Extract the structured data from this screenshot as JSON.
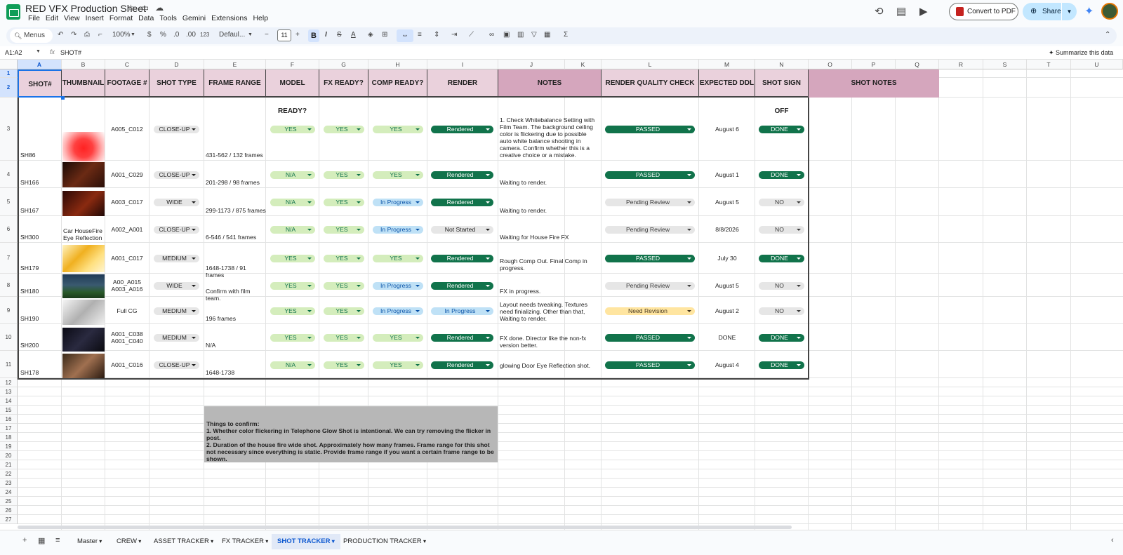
{
  "app": {
    "title": "RED VFX Production Sheet",
    "menu": [
      "File",
      "Edit",
      "View",
      "Insert",
      "Format",
      "Data",
      "Tools",
      "Gemini",
      "Extensions",
      "Help"
    ],
    "convert_label": "Convert to PDF",
    "share_label": "Share"
  },
  "toolbar": {
    "search_label": "Menus",
    "zoom": "100%",
    "currency": "$",
    "percent": "%",
    "dec_dec": ".0",
    "dec_inc": ".00",
    "num_format": "123",
    "font": "Defaul...",
    "font_size": "11"
  },
  "formula_bar": {
    "name_box": "A1:A2",
    "fx": "fx",
    "value": "SHOT#",
    "summarize": "Summarize this data"
  },
  "columns": [
    "A",
    "B",
    "C",
    "D",
    "E",
    "F",
    "G",
    "H",
    "I",
    "J",
    "K",
    "L",
    "M",
    "N",
    "O",
    "P",
    "Q",
    "R",
    "S",
    "T",
    "U"
  ],
  "row_numbers": [
    "1",
    "2",
    "3",
    "4",
    "5",
    "6",
    "7",
    "8",
    "9",
    "10",
    "11",
    "12",
    "13",
    "14",
    "15",
    "16",
    "17",
    "18",
    "19",
    "20",
    "21",
    "22",
    "23",
    "24",
    "25",
    "26",
    "27"
  ],
  "headers": {
    "shot": "SHOT#",
    "thumbnail": "THUMBNAIL",
    "footage": "FOOTAGE #",
    "shot_type": "SHOT TYPE",
    "frame_range": "FRAME RANGE",
    "model_ready": "MODEL READY?",
    "fx_ready": "FX READY?",
    "comp_ready": "COMP READY?",
    "render": "RENDER",
    "notes": "NOTES",
    "render_qc": "RENDER QUALITY CHECK",
    "expected_ddl": "EXPECTED DDL",
    "sign_off": "SHOT SIGN OFF",
    "shot_notes": "SHOT NOTES"
  },
  "rows": [
    {
      "shot": "SH86",
      "thumb_text": "",
      "footage": "A005_C012",
      "type": "CLOSE-UP",
      "frames": "431-562 / 132 frames",
      "model": "YES",
      "fx": "YES",
      "comp": "YES",
      "render": "Rendered",
      "notes": "1. Check Whitebalance Setting with Film Team. The background ceiling color is flickering due to possible auto white balance shooting in camera. Confirm whether this is a creative choice or a mistake.",
      "qc": "PASSED",
      "ddl": "August 6",
      "signoff": "DONE"
    },
    {
      "shot": "SH166",
      "thumb_text": "",
      "footage": "A001_C029",
      "type": "CLOSE-UP",
      "frames": "201-298 / 98 frames",
      "model": "N/A",
      "fx": "YES",
      "comp": "YES",
      "render": "Rendered",
      "notes": "Waiting to render.",
      "qc": "PASSED",
      "ddl": "August 1",
      "signoff": "DONE"
    },
    {
      "shot": "SH167",
      "thumb_text": "",
      "footage": "A003_C017",
      "type": "WIDE",
      "frames": "299-1173 / 875 frames",
      "model": "N/A",
      "fx": "YES",
      "comp": "In Progress",
      "render": "Rendered",
      "notes": "Waiting to render.",
      "qc": "Pending Review",
      "ddl": "August 5",
      "signoff": "NO"
    },
    {
      "shot": "SH300",
      "thumb_text": "Car HouseFire Eye Reflection",
      "footage": "A002_A001",
      "type": "CLOSE-UP",
      "frames": "6-546 / 541 frames",
      "model": "N/A",
      "fx": "YES",
      "comp": "In Progress",
      "render": "Not Started",
      "notes": "Waiting for House Fire FX",
      "qc": "Pending Review",
      "ddl": "8/8/2026",
      "signoff": "NO"
    },
    {
      "shot": "SH179",
      "thumb_text": "",
      "footage": "A001_C017",
      "type": "MEDIUM",
      "frames": "1648-1738 / 91 frames",
      "model": "YES",
      "fx": "YES",
      "comp": "YES",
      "render": "Rendered",
      "notes": "Rough Comp Out. Final Comp in progress.",
      "qc": "PASSED",
      "ddl": "July 30",
      "signoff": "DONE"
    },
    {
      "shot": "SH180",
      "thumb_text": "",
      "footage": "A00_A015 A003_A016",
      "type": "WIDE",
      "frames": "Confirm with film team.",
      "model": "YES",
      "fx": "YES",
      "comp": "In Progress",
      "render": "Rendered",
      "notes": "FX in progress.",
      "qc": "Pending Review",
      "ddl": "August 5",
      "signoff": "NO"
    },
    {
      "shot": "SH190",
      "thumb_text": "",
      "footage": "Full CG",
      "type": "MEDIUM",
      "frames": "196 frames",
      "model": "YES",
      "fx": "YES",
      "comp": "In Progress",
      "render": "In Progress",
      "notes": "Layout needs tweaking. Textures need finializing. Other than that, Waiting to render.",
      "qc": "Need Revision",
      "ddl": "August 2",
      "signoff": "NO"
    },
    {
      "shot": "SH200",
      "thumb_text": "",
      "footage": "A001_C038 A001_C040",
      "type": "MEDIUM",
      "frames": "N/A",
      "model": "YES",
      "fx": "YES",
      "comp": "YES",
      "render": "Rendered",
      "notes": "FX done. Director like the non-fx version better.",
      "qc": "PASSED",
      "ddl": "DONE",
      "signoff": "DONE"
    },
    {
      "shot": "SH178",
      "thumb_text": "",
      "footage": "A001_C016",
      "type": "CLOSE-UP",
      "frames": "1648-1738",
      "model": "N/A",
      "fx": "YES",
      "comp": "YES",
      "render": "Rendered",
      "notes": "glowing Door Eye Reflection shot.",
      "qc": "PASSED",
      "ddl": "August 4",
      "signoff": "DONE"
    }
  ],
  "note_box": {
    "title": "Things to confirm:",
    "line1": "1. Whether color flickering in Telephone Glow Shot is intentional. We can try removing the flicker in post.",
    "line2": "2. Duration of the house fire wide shot. Approximately how many frames. Frame range for this shot not necessary since everything is static. Provide frame range if you want a certain frame range to be shown."
  },
  "sheet_tabs": [
    "Master",
    "CREW",
    "ASSET TRACKER",
    "FX TRACKER",
    "SHOT TRACKER",
    "PRODUCTION TRACKER"
  ],
  "active_tab": "SHOT TRACKER",
  "icons": [
    "star-icon",
    "folder-icon",
    "cloud-icon",
    "history-icon",
    "comment-icon",
    "meet-icon",
    "pdf-icon",
    "globe-icon",
    "gemini-icon",
    "undo-icon",
    "redo-icon",
    "print-icon",
    "paint-format-icon",
    "bold-icon",
    "italic-icon",
    "strikethrough-icon",
    "text-color-icon",
    "fill-color-icon",
    "borders-icon",
    "merge-icon",
    "align-icon",
    "link-icon",
    "comment-add-icon",
    "chart-icon",
    "filter-icon",
    "function-icon",
    "add-sheet-icon",
    "sheets-list-icon"
  ],
  "colors": {
    "header_pink": "#ead1dc",
    "header_dark_pink": "#d5a6bd",
    "pill_green_light": "#d4edbc",
    "pill_green_dark": "#11734b",
    "pill_blue": "#bfe1f6",
    "pill_yellow": "#ffe5a0",
    "note_gray": "#b7b7b7"
  }
}
